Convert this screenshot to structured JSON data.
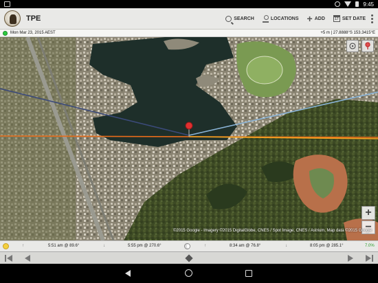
{
  "status_bar": {
    "time": "9:45"
  },
  "app": {
    "title": "TPE"
  },
  "toolbar": {
    "search_label": "SEARCH",
    "locations_label": "LOCATIONS",
    "add_label": "ADD",
    "set_date_label": "SET DATE",
    "calendar_icon_text": "17"
  },
  "info": {
    "date": "Mon Mar 23, 2015 AEST",
    "coordinates": "+5 m | 27.8888°S 153.3415°E"
  },
  "map": {
    "attribution": "©2015 Google - Imagery ©2015 DigitalGlobe, CNES / Spot Image, CNES / Astrium, Map data ©2015 Google",
    "zoom_in": "+",
    "zoom_out": "−"
  },
  "ephemeris": {
    "sunrise": "5:51 am @ 89.6°",
    "sunset": "5:55 pm @ 270.6°",
    "moonrise": "8:34 am @ 76.8°",
    "moonset": "8:05 pm @ 285.1°",
    "moon_illumination": "7.0%",
    "rise_arrow": "↑",
    "set_arrow": "↓"
  },
  "icons": {
    "app_logo": "elephant-logo-icon",
    "search": "search-icon",
    "locations": "map-pin-icon",
    "add": "plus-icon",
    "set_date": "calendar-icon",
    "overflow": "overflow-menu-icon",
    "gps": "gps-status-icon",
    "sun": "sun-icon",
    "moon": "moon-icon",
    "map_pin": "red-map-pin-icon"
  },
  "colors": {
    "sunrise_line": "#f5a623",
    "sunset_line": "#e86c1a",
    "moonrise_line": "#8ab4d8",
    "moonset_line": "#3b4a7a",
    "pin": "#e03030",
    "gps_on": "#2ecc40"
  }
}
